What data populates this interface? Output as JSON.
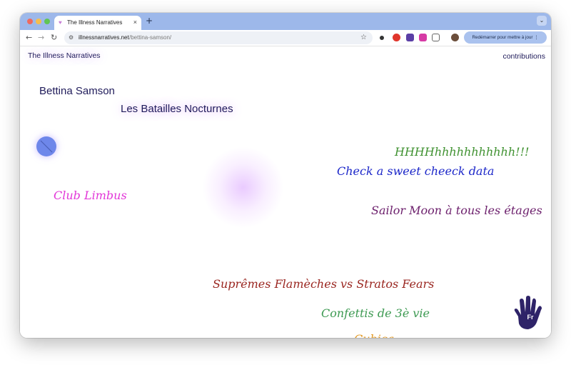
{
  "browser": {
    "tab_title": "The Illness Narratives",
    "tab_favicon": "heart-icon",
    "new_tab": "+",
    "tab_close": "×",
    "tab_menu": "⌄",
    "url_host": "illnessnarratives.net",
    "url_path": "/bettina-samson/",
    "relaunch_label": "Redémarrer pour mettre à jour ⋮",
    "extensions": [
      "dots-extension-icon",
      "opera-icon",
      "purple-extension-icon",
      "instagram-extension-icon",
      "puzzle-extension-icon",
      "profile-avatar"
    ]
  },
  "page": {
    "site_title": "The Illness Narratives",
    "contributions": "contributions",
    "author": "Bettina Samson",
    "work_title": "Les Batailles Nocturnes",
    "language_badge": "Fr",
    "scribbles": [
      {
        "text": "HHHHhhhhhhhhhhh!!!",
        "color": "#3f9130"
      },
      {
        "text": "Check a sweet cheeck data",
        "color": "#1c27c9"
      },
      {
        "text": "Club Limbus",
        "color": "#e236d8"
      },
      {
        "text": "Sailor Moon à tous les étages",
        "color": "#6b1e6b"
      },
      {
        "text": "Suprêmes Flamèches vs Stratos Fears",
        "color": "#9a2620"
      },
      {
        "text": "Confettis de 3è vie",
        "color": "#3d9a52"
      },
      {
        "text": "Cubica ... ... ...",
        "color": "#e39a25"
      }
    ]
  }
}
